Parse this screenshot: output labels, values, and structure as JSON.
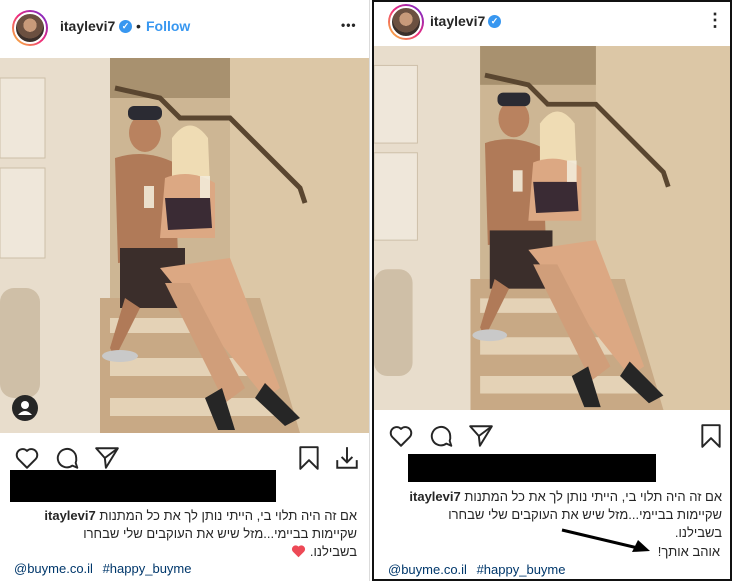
{
  "left": {
    "username": "itaylevi7",
    "separator": "•",
    "follow_label": "Follow",
    "more_label": "•••",
    "caption_user": "itaylevi7",
    "caption_line1": "אם זה היה תלוי בי, הייתי נותן לך את כל המתנות",
    "caption_line2": "שקיימות בביימי...מזל שיש את העוקבים שלי שבחרו",
    "caption_line3": "בשבילנו.",
    "tag1": "@buyme.co.il",
    "tag2": "#happy_buyme"
  },
  "right": {
    "username": "itaylevi7",
    "more_label": "⋮",
    "caption_user": "itaylevi7",
    "caption_line1": "אם זה היה תלוי בי, הייתי נותן לך את כל המתנות",
    "caption_line2": "שקיימות בביימי...מזל שיש את העוקבים שלי שבחרו",
    "caption_line3": "בשבילנו.",
    "note": "אוהב אותך!",
    "tag1": "@buyme.co.il",
    "tag2": "#happy_buyme"
  },
  "colors": {
    "verified": "#3897f0",
    "follow": "#3897f0",
    "heart": "#ed4956",
    "link": "#00376b"
  },
  "icons": [
    "heart-icon",
    "comment-icon",
    "share-icon",
    "bookmark-icon",
    "download-icon",
    "more-icon",
    "verified-icon",
    "user-tag-icon",
    "heart-emoji-icon",
    "arrow-annotation-icon"
  ]
}
